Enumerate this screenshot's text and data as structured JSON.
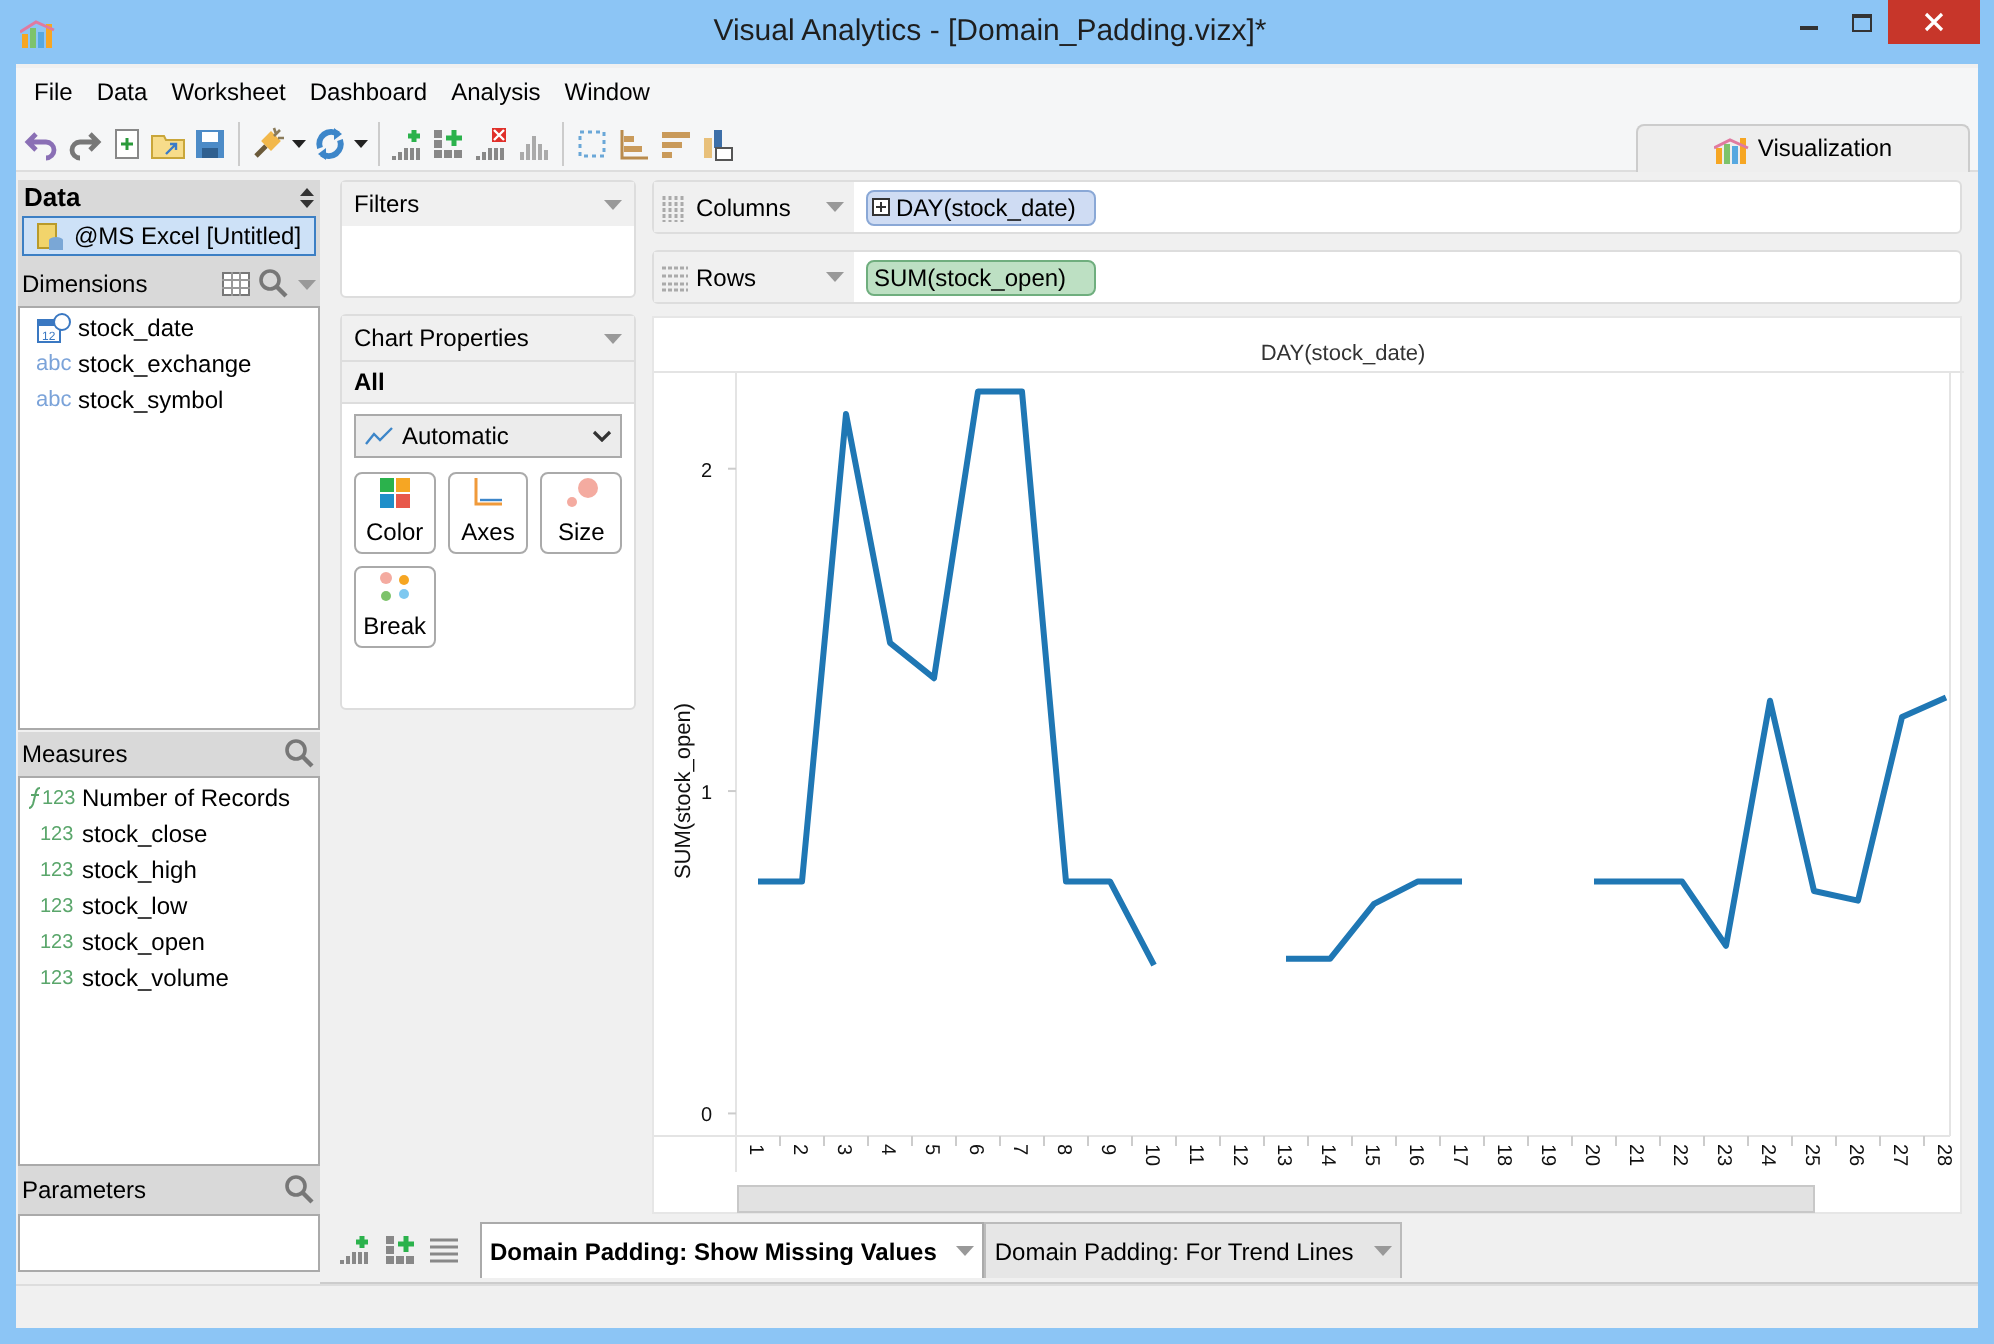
{
  "window": {
    "title": "Visual Analytics - [Domain_Padding.vizx]*"
  },
  "menu": [
    "File",
    "Data",
    "Worksheet",
    "Dashboard",
    "Analysis",
    "Window"
  ],
  "toolbar_tab": {
    "label": "Visualization"
  },
  "data_panel": {
    "title": "Data",
    "source": {
      "label": "@MS Excel [Untitled]",
      "selected": true
    }
  },
  "dimensions": {
    "title": "Dimensions",
    "items": [
      {
        "label": "stock_date",
        "kind": "date"
      },
      {
        "label": "stock_exchange",
        "kind": "text",
        "type_label": "abc"
      },
      {
        "label": "stock_symbol",
        "kind": "text",
        "type_label": "abc"
      }
    ]
  },
  "measures": {
    "title": "Measures",
    "items": [
      {
        "label": "Number of Records",
        "kind": "calculated",
        "type_label": "123"
      },
      {
        "label": "stock_close",
        "kind": "number",
        "type_label": "123"
      },
      {
        "label": "stock_high",
        "kind": "number",
        "type_label": "123"
      },
      {
        "label": "stock_low",
        "kind": "number",
        "type_label": "123"
      },
      {
        "label": "stock_open",
        "kind": "number",
        "type_label": "123"
      },
      {
        "label": "stock_volume",
        "kind": "number",
        "type_label": "123"
      }
    ]
  },
  "parameters": {
    "title": "Parameters"
  },
  "filters": {
    "title": "Filters"
  },
  "chart_properties": {
    "title": "Chart Properties",
    "section": "All",
    "mark_type": "Automatic",
    "buttons": [
      {
        "label": "Color",
        "kind": "color"
      },
      {
        "label": "Axes",
        "kind": "axes"
      },
      {
        "label": "Size",
        "kind": "size"
      },
      {
        "label": "Break",
        "kind": "break"
      }
    ]
  },
  "shelves": [
    {
      "label": "Columns",
      "pill": "DAY(stock_date)",
      "kind": "dimension"
    },
    {
      "label": "Rows",
      "pill": "SUM(stock_open)",
      "kind": "measure"
    }
  ],
  "chart": {
    "chart_data": {
      "type": "line",
      "xlabel": "DAY(stock_date)",
      "ylabel": "SUM(stock_open)",
      "categories": [
        "1",
        "2",
        "3",
        "4",
        "5",
        "6",
        "7",
        "8",
        "9",
        "10",
        "11",
        "12",
        "13",
        "14",
        "15",
        "16",
        "17",
        "18",
        "19",
        "20",
        "21",
        "22",
        "23",
        "24",
        "25",
        "26",
        "27",
        "28"
      ],
      "series": [
        {
          "color": "#1f77b4",
          "values": [
            0.72,
            0.72,
            2.17,
            1.46,
            1.35,
            2.24,
            2.24,
            0.72,
            0.72,
            0.46,
            null,
            null,
            0.48,
            0.48,
            0.65,
            0.72,
            0.72,
            null,
            null,
            0.72,
            0.72,
            0.72,
            0.52,
            1.28,
            0.69,
            0.66,
            1.23,
            1.29
          ]
        }
      ],
      "ylim": [
        -0.07,
        2.3
      ],
      "yticks": [
        0,
        1,
        2
      ]
    }
  },
  "sheet_tabs": [
    {
      "label": "Domain Padding: Show Missing Values",
      "selected": true
    },
    {
      "label": "Domain Padding: For Trend Lines",
      "selected": false
    }
  ]
}
